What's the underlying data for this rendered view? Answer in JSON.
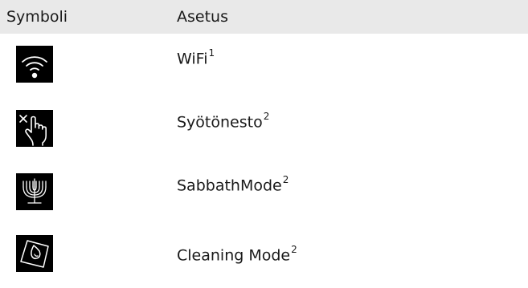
{
  "table": {
    "headers": {
      "symbol": "Symboli",
      "setting": "Asetus"
    },
    "rows": [
      {
        "icon": "wifi-icon",
        "label": "WiFi",
        "footnote": "1"
      },
      {
        "icon": "touch-lock-icon",
        "label": "Syötönesto",
        "footnote": "2"
      },
      {
        "icon": "menorah-icon",
        "label": "SabbathMode",
        "footnote": "2"
      },
      {
        "icon": "cleaning-icon",
        "label": "Cleaning Mode",
        "footnote": "2"
      }
    ]
  },
  "colors": {
    "header_background": "#e9e9e9",
    "icon_background": "#000000",
    "icon_foreground": "#ffffff",
    "text": "#1a1a1a"
  }
}
